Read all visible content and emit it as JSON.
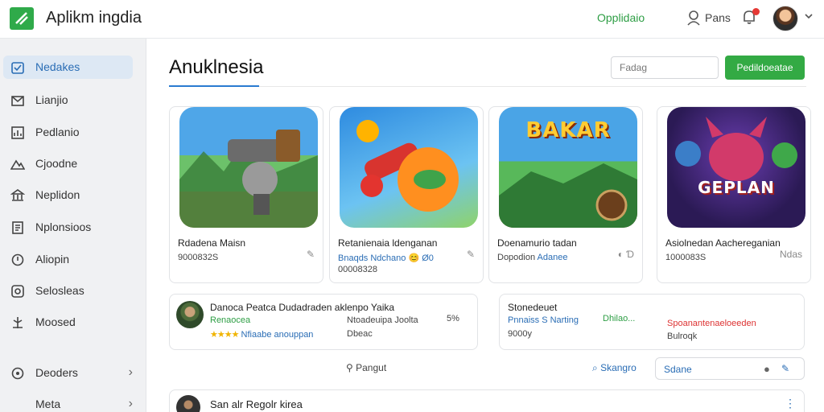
{
  "app": {
    "title": "Aplikm ingdia",
    "top_link": "Opplidaio",
    "user_name": "Pans"
  },
  "sidebar": {
    "items": [
      {
        "label": "Nedakes",
        "icon": "calendar-icon"
      },
      {
        "label": "Lianjio",
        "icon": "mail-icon"
      },
      {
        "label": "Pedlanio",
        "icon": "chart-icon"
      },
      {
        "label": "Cjoodne",
        "icon": "mountain-icon"
      },
      {
        "label": "Neplidon",
        "icon": "bank-icon"
      },
      {
        "label": "Nplonsioos",
        "icon": "document-icon"
      },
      {
        "label": "Aliopin",
        "icon": "circle-icon"
      },
      {
        "label": "Selosleas",
        "icon": "settings-icon"
      },
      {
        "label": "Moosed",
        "icon": "tree-icon"
      },
      {
        "label": "Deoders",
        "icon": "compass-icon"
      },
      {
        "label": "Meta",
        "icon": "none"
      }
    ]
  },
  "main": {
    "title": "Anuklnesia",
    "search_placeholder": "Fadag",
    "primary_button": "Pedildoeatae"
  },
  "cards": [
    {
      "name": "Rdadena Maisn",
      "meta": "9000832S",
      "meta_accent": "",
      "action": "✎",
      "thumb_text": ""
    },
    {
      "name": "Retanienaia ldenganan",
      "meta": "Bnaqds Ndchano 😊 Ø0",
      "meta2": "00008328",
      "meta_accent": "",
      "action": "✎",
      "thumb_text": ""
    },
    {
      "name": "Doenamurio tadan",
      "meta": "Dopodion",
      "meta_accent": "Adanee",
      "action": "◐ Ɗ",
      "thumb_text": "BAKAR"
    },
    {
      "name": "Asiolnedan Aachereganian",
      "meta": "1000083S",
      "meta_accent": "",
      "action": "Ndas",
      "thumb_text": "GEPLAN"
    }
  ],
  "reviews": [
    {
      "title": "Danoca Peatca Dudadraden aklenpo Yaika",
      "line1": "Renaocea",
      "line1_right": "Ntoadeuipa Joolta",
      "line1_count": "5%",
      "stars": "★★★★",
      "line2_accent": "Nfiaabe anouppan",
      "line2_right": "Dbeac"
    },
    {
      "title": "Stonedeuet",
      "line1": "Pnnaiss S Narting",
      "line1_mid": "Dhilao...",
      "line2": "9000y",
      "red_line": "Spoanantenaeloeeden",
      "line3": "Bulroqk"
    }
  ],
  "bottom": {
    "center_label": "Pangut",
    "search_label": "Skangro",
    "chip_label": "Sdane"
  },
  "feed": {
    "title": "San alr  Regolr kirea"
  },
  "colors": {
    "brand_green": "#33aa44",
    "accent_blue": "#2a6db5",
    "alert_red": "#e53935"
  }
}
